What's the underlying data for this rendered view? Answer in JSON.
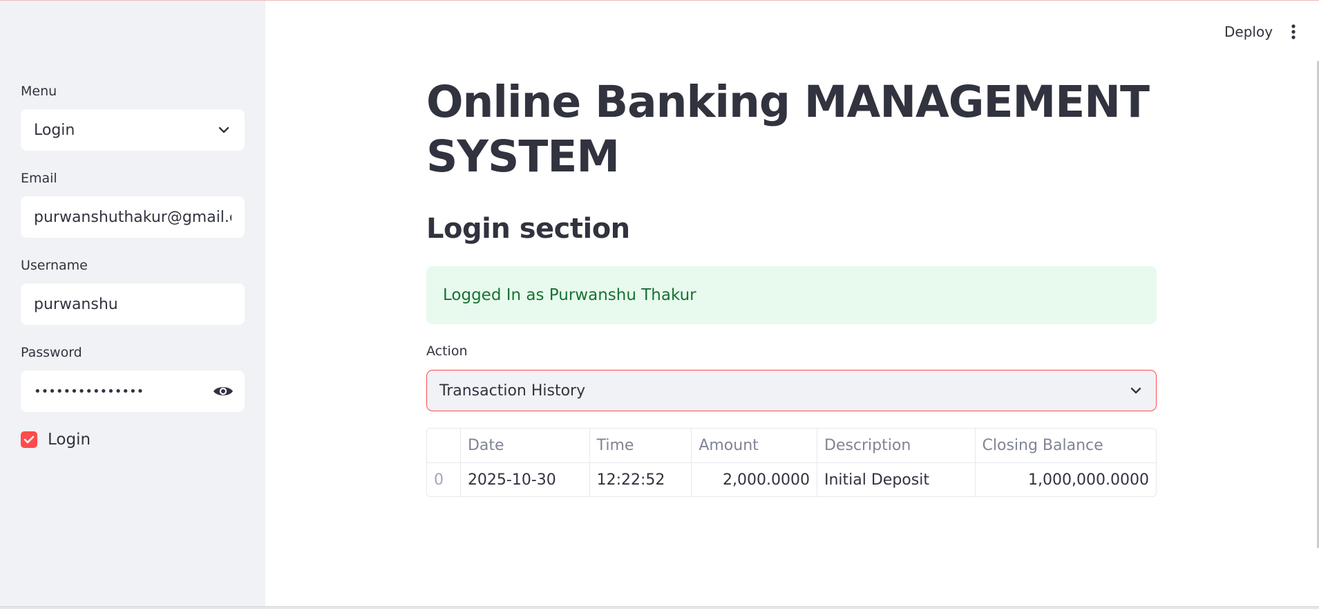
{
  "header": {
    "deploy_label": "Deploy",
    "more_icon": "vertical-ellipsis-icon"
  },
  "sidebar": {
    "menu": {
      "label": "Menu",
      "value": "Login"
    },
    "email": {
      "label": "Email",
      "value": "purwanshuthakur@gmail.com"
    },
    "username": {
      "label": "Username",
      "value": "purwanshu"
    },
    "password": {
      "label": "Password",
      "value": "•••••••••••••••"
    },
    "login_checkbox": {
      "label": "Login",
      "checked": true
    }
  },
  "main": {
    "title": "Online Banking MANAGEMENT SYSTEM",
    "section_title": "Login section",
    "alert": "Logged In as Purwanshu Thakur",
    "action": {
      "label": "Action",
      "value": "Transaction History"
    },
    "table": {
      "columns": [
        "",
        "Date",
        "Time",
        "Amount",
        "Description",
        "Closing Balance"
      ],
      "rows": [
        [
          "0",
          "2025-10-30",
          "12:22:52",
          "2,000.0000",
          "Initial Deposit",
          "1,000,000.0000"
        ]
      ]
    }
  },
  "colors": {
    "accent": "#ff4b4b",
    "sidebar_bg": "#f0f2f6",
    "success_bg": "#e8f9ee",
    "success_text": "#177233",
    "text": "#31333f"
  }
}
